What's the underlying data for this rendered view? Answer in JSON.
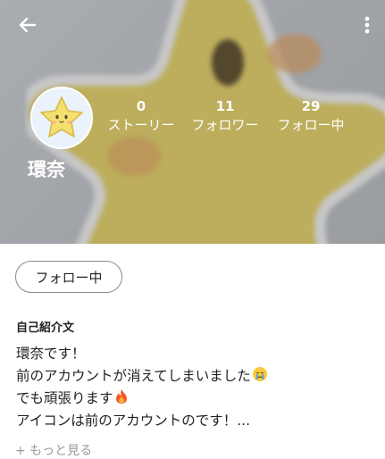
{
  "header": {
    "back_icon": "arrow-left-icon",
    "more_icon": "more-vertical-icon"
  },
  "profile": {
    "name": "環奈",
    "stats": [
      {
        "value": "0",
        "label": "ストーリー"
      },
      {
        "value": "11",
        "label": "フォロワー"
      },
      {
        "value": "29",
        "label": "フォロー中"
      }
    ],
    "follow_button_label": "フォロー中"
  },
  "bio": {
    "title": "自己紹介文",
    "lines": [
      "環奈です！",
      "前のアカウントが消えてしまいました",
      "でも頑張ります",
      "アイコンは前のアカウントのです！..."
    ],
    "line2_emoji": "crying-face-icon",
    "line3_emoji": "fire-icon",
    "more_label": "+ もっと見る"
  },
  "colors": {
    "header_overlay": "#7d8087",
    "star_yellow": "#f4e27a",
    "star_outline": "#ffffff",
    "button_border": "#8a8a8a",
    "muted_text": "#9a9a9a"
  }
}
